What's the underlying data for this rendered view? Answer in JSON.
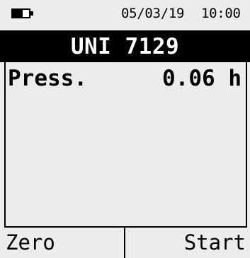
{
  "status": {
    "battery_icon": "battery-half-icon",
    "date": "05/03/19",
    "time": "10:00"
  },
  "header": {
    "title": "UNI 7129"
  },
  "measurement": {
    "label": "Press.",
    "value": "0.06 h"
  },
  "softkeys": {
    "left_label": "Zero",
    "right_label": "Start"
  },
  "colors": {
    "background": "#ececec",
    "header_background": "#000000",
    "header_text": "#ffffff",
    "text": "#000000"
  }
}
